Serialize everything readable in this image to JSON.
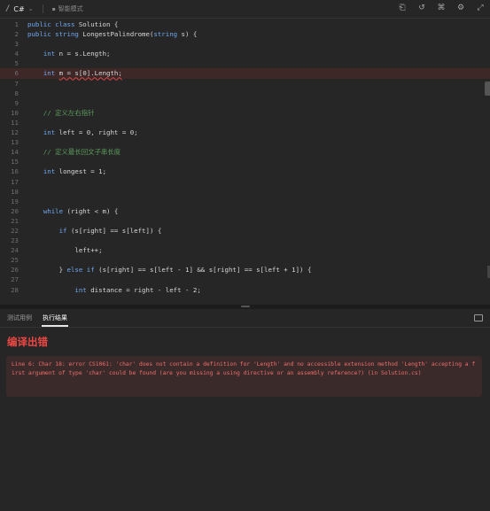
{
  "toolbar": {
    "language": "C#",
    "smart_mode": "智能模式"
  },
  "code_lines": [
    {
      "num": "1",
      "text": "public class Solution {"
    },
    {
      "num": "2",
      "text": "public string LongestPalindrome(string s) {"
    },
    {
      "num": "3",
      "text": ""
    },
    {
      "num": "4",
      "text": "    int n = s.Length;"
    },
    {
      "num": "5",
      "text": ""
    },
    {
      "num": "6",
      "text": "    int m = s[0].Length;"
    },
    {
      "num": "7",
      "text": ""
    },
    {
      "num": "8",
      "text": ""
    },
    {
      "num": "9",
      "text": ""
    },
    {
      "num": "10",
      "text": "    // 定义左右指针"
    },
    {
      "num": "11",
      "text": ""
    },
    {
      "num": "12",
      "text": "    int left = 0, right = 0;"
    },
    {
      "num": "13",
      "text": ""
    },
    {
      "num": "14",
      "text": "    // 定义最长回文子串长度"
    },
    {
      "num": "15",
      "text": ""
    },
    {
      "num": "16",
      "text": "    int longest = 1;"
    },
    {
      "num": "17",
      "text": ""
    },
    {
      "num": "18",
      "text": ""
    },
    {
      "num": "19",
      "text": ""
    },
    {
      "num": "20",
      "text": "    while (right < m) {"
    },
    {
      "num": "21",
      "text": ""
    },
    {
      "num": "22",
      "text": "        if (s[right] == s[left]) {"
    },
    {
      "num": "23",
      "text": ""
    },
    {
      "num": "24",
      "text": "            left++;"
    },
    {
      "num": "25",
      "text": ""
    },
    {
      "num": "26",
      "text": "        } else if (s[right] == s[left - 1] && s[right] == s[left + 1]) {"
    },
    {
      "num": "27",
      "text": ""
    },
    {
      "num": "28",
      "text": "            int distance = right - left - 2;"
    }
  ],
  "bottom_panel": {
    "tabs": [
      "测试用例",
      "执行结果"
    ],
    "result_title": "编译出错",
    "error_message": "Line 6: Char 18: error CS1061: 'char' does not contain a definition for 'Length' and no accessible extension method 'Length' accepting a first argument of type 'char' could be found (are you missing a using directive or an assembly reference?) (in Solution.cs)"
  },
  "colors": {
    "keyword": "#6fa8f0",
    "comment": "#5b9b5b",
    "error_red": "#ef4743"
  }
}
